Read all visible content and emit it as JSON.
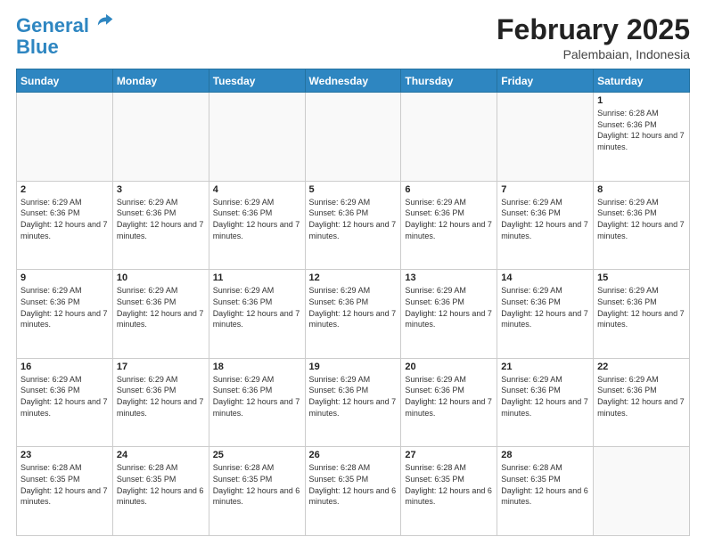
{
  "logo": {
    "line1": "General",
    "line2": "Blue"
  },
  "header": {
    "title": "February 2025",
    "subtitle": "Palembaian, Indonesia"
  },
  "days_of_week": [
    "Sunday",
    "Monday",
    "Tuesday",
    "Wednesday",
    "Thursday",
    "Friday",
    "Saturday"
  ],
  "weeks": [
    [
      {
        "num": "",
        "info": ""
      },
      {
        "num": "",
        "info": ""
      },
      {
        "num": "",
        "info": ""
      },
      {
        "num": "",
        "info": ""
      },
      {
        "num": "",
        "info": ""
      },
      {
        "num": "",
        "info": ""
      },
      {
        "num": "1",
        "info": "Sunrise: 6:28 AM\nSunset: 6:36 PM\nDaylight: 12 hours and 7 minutes."
      }
    ],
    [
      {
        "num": "2",
        "info": "Sunrise: 6:29 AM\nSunset: 6:36 PM\nDaylight: 12 hours and 7 minutes."
      },
      {
        "num": "3",
        "info": "Sunrise: 6:29 AM\nSunset: 6:36 PM\nDaylight: 12 hours and 7 minutes."
      },
      {
        "num": "4",
        "info": "Sunrise: 6:29 AM\nSunset: 6:36 PM\nDaylight: 12 hours and 7 minutes."
      },
      {
        "num": "5",
        "info": "Sunrise: 6:29 AM\nSunset: 6:36 PM\nDaylight: 12 hours and 7 minutes."
      },
      {
        "num": "6",
        "info": "Sunrise: 6:29 AM\nSunset: 6:36 PM\nDaylight: 12 hours and 7 minutes."
      },
      {
        "num": "7",
        "info": "Sunrise: 6:29 AM\nSunset: 6:36 PM\nDaylight: 12 hours and 7 minutes."
      },
      {
        "num": "8",
        "info": "Sunrise: 6:29 AM\nSunset: 6:36 PM\nDaylight: 12 hours and 7 minutes."
      }
    ],
    [
      {
        "num": "9",
        "info": "Sunrise: 6:29 AM\nSunset: 6:36 PM\nDaylight: 12 hours and 7 minutes."
      },
      {
        "num": "10",
        "info": "Sunrise: 6:29 AM\nSunset: 6:36 PM\nDaylight: 12 hours and 7 minutes."
      },
      {
        "num": "11",
        "info": "Sunrise: 6:29 AM\nSunset: 6:36 PM\nDaylight: 12 hours and 7 minutes."
      },
      {
        "num": "12",
        "info": "Sunrise: 6:29 AM\nSunset: 6:36 PM\nDaylight: 12 hours and 7 minutes."
      },
      {
        "num": "13",
        "info": "Sunrise: 6:29 AM\nSunset: 6:36 PM\nDaylight: 12 hours and 7 minutes."
      },
      {
        "num": "14",
        "info": "Sunrise: 6:29 AM\nSunset: 6:36 PM\nDaylight: 12 hours and 7 minutes."
      },
      {
        "num": "15",
        "info": "Sunrise: 6:29 AM\nSunset: 6:36 PM\nDaylight: 12 hours and 7 minutes."
      }
    ],
    [
      {
        "num": "16",
        "info": "Sunrise: 6:29 AM\nSunset: 6:36 PM\nDaylight: 12 hours and 7 minutes."
      },
      {
        "num": "17",
        "info": "Sunrise: 6:29 AM\nSunset: 6:36 PM\nDaylight: 12 hours and 7 minutes."
      },
      {
        "num": "18",
        "info": "Sunrise: 6:29 AM\nSunset: 6:36 PM\nDaylight: 12 hours and 7 minutes."
      },
      {
        "num": "19",
        "info": "Sunrise: 6:29 AM\nSunset: 6:36 PM\nDaylight: 12 hours and 7 minutes."
      },
      {
        "num": "20",
        "info": "Sunrise: 6:29 AM\nSunset: 6:36 PM\nDaylight: 12 hours and 7 minutes."
      },
      {
        "num": "21",
        "info": "Sunrise: 6:29 AM\nSunset: 6:36 PM\nDaylight: 12 hours and 7 minutes."
      },
      {
        "num": "22",
        "info": "Sunrise: 6:29 AM\nSunset: 6:36 PM\nDaylight: 12 hours and 7 minutes."
      }
    ],
    [
      {
        "num": "23",
        "info": "Sunrise: 6:28 AM\nSunset: 6:35 PM\nDaylight: 12 hours and 7 minutes."
      },
      {
        "num": "24",
        "info": "Sunrise: 6:28 AM\nSunset: 6:35 PM\nDaylight: 12 hours and 6 minutes."
      },
      {
        "num": "25",
        "info": "Sunrise: 6:28 AM\nSunset: 6:35 PM\nDaylight: 12 hours and 6 minutes."
      },
      {
        "num": "26",
        "info": "Sunrise: 6:28 AM\nSunset: 6:35 PM\nDaylight: 12 hours and 6 minutes."
      },
      {
        "num": "27",
        "info": "Sunrise: 6:28 AM\nSunset: 6:35 PM\nDaylight: 12 hours and 6 minutes."
      },
      {
        "num": "28",
        "info": "Sunrise: 6:28 AM\nSunset: 6:35 PM\nDaylight: 12 hours and 6 minutes."
      },
      {
        "num": "",
        "info": ""
      }
    ]
  ]
}
